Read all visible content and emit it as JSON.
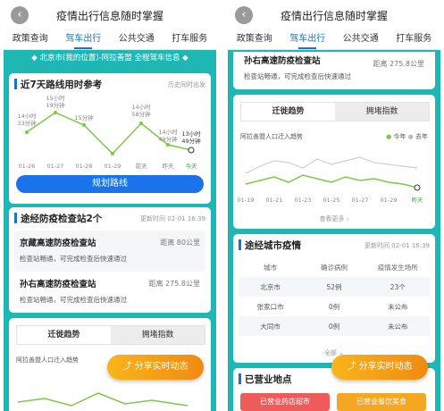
{
  "header": {
    "title": "疫情出行信息随时掌握",
    "back_icon": "‹"
  },
  "tabs": [
    {
      "label": "政策查询"
    },
    {
      "label": "驾车出行",
      "active": true
    },
    {
      "label": "公共交通"
    },
    {
      "label": "打车服务"
    }
  ],
  "route_banner": "北京市(我的位置)-阿拉善盟 全程驾车信息",
  "route_time": {
    "title": "近7天路线用时参考",
    "note": "历史同时出发",
    "x_labels": [
      "01-26",
      "01-27",
      "01-28",
      "01-29",
      "前天",
      "昨天",
      "今天"
    ],
    "point_labels": [
      "14小时\n33分钟",
      "15小时\n19分钟",
      "15分钟",
      "14小时\n58分钟",
      "",
      "14小时\n49分钟",
      "13小时\n49分钟"
    ],
    "button": "规划路线"
  },
  "checkpoints": {
    "title": "途经防疫检查站2个",
    "updated": "更新时间 02-01 16:39",
    "items": [
      {
        "name": "京藏高速防疫检查站",
        "distance": "距离 80公里",
        "desc": "检查站畅通，可完成检查后快速通过"
      },
      {
        "name": "孙右高速防疫检查站",
        "distance": "距离 275.8公里",
        "desc": "检查站畅通，可完成检查后快速通过"
      }
    ]
  },
  "migration": {
    "tab_trend": "迁徙趋势",
    "tab_congestion": "拥堵指数",
    "chart_title": "阿拉善盟人口迁入趋势",
    "legend_today": "今年",
    "legend_lastyear": "去年",
    "x_labels": [
      "01-19",
      "01-21",
      "01-23",
      "01-25",
      "01-27",
      "01-29",
      "昨天"
    ],
    "see_more": "查看更多"
  },
  "city_epidemic": {
    "title": "途经城市疫情",
    "updated": "更新时间 02-01 16:39",
    "headers": [
      "城市",
      "确诊病例",
      "疫情发生场所"
    ],
    "rows": [
      [
        "北京市",
        "52例",
        "23个"
      ],
      [
        "张家口市",
        "0例",
        "未公布"
      ],
      [
        "大同市",
        "0例",
        "未公布"
      ]
    ],
    "expand": "全部"
  },
  "open_places": {
    "title": "已营业地点",
    "tag1": "已营业药店超市",
    "tag2": "已营业餐饮美食"
  },
  "share_button": "分享实时动态",
  "colors": {
    "teal": "#1fb7b3",
    "blue": "#1a73e8",
    "green": "#7cc84a",
    "orange": "#f39a14"
  }
}
